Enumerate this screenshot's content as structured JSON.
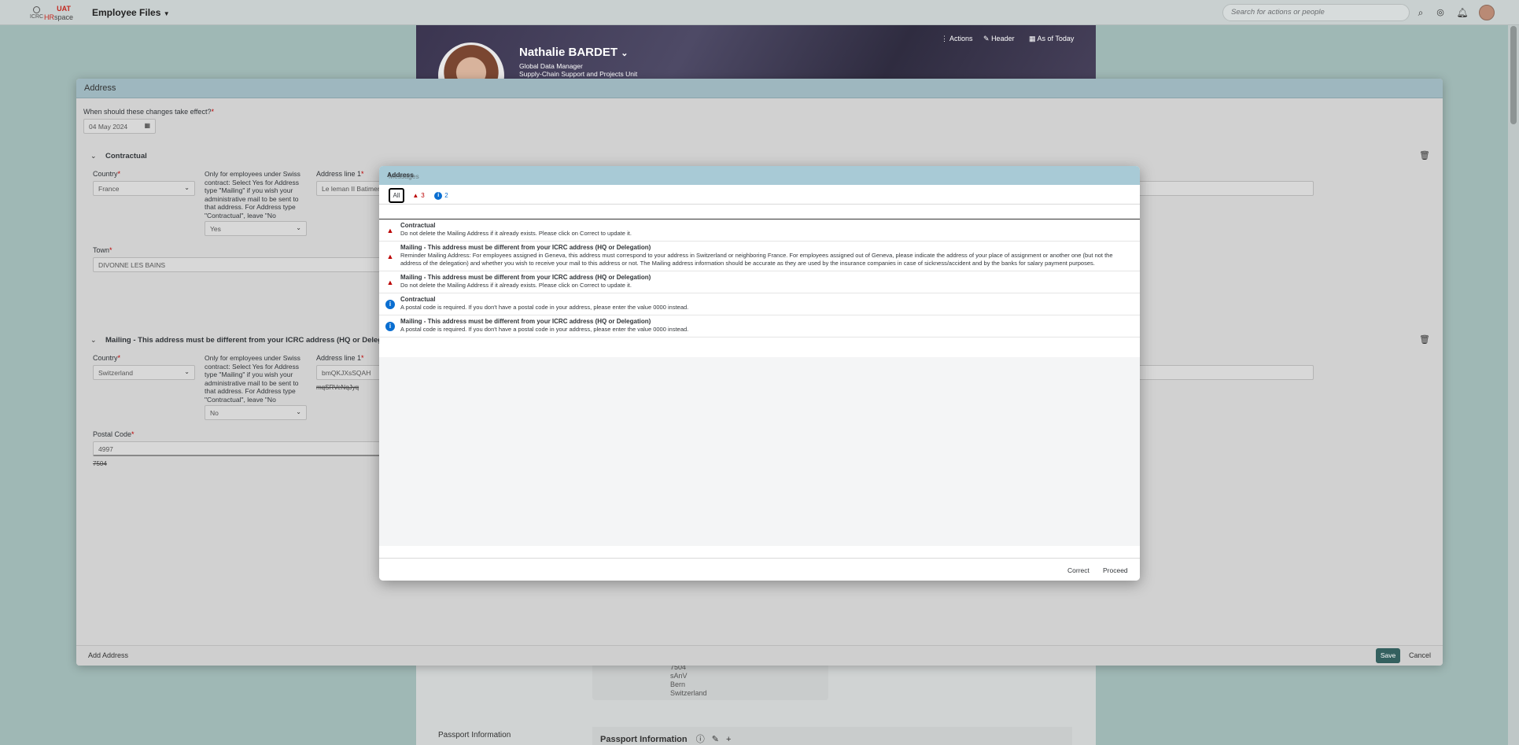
{
  "shell": {
    "logo_uat": "UAT",
    "logo_icrc": "ICRC",
    "logo_hr": "HR",
    "logo_space": "space",
    "app_title": "Employee Files",
    "search_placeholder": "Search for actions or people"
  },
  "profile": {
    "name": "Nathalie BARDET",
    "title": "Global Data Manager",
    "unit": "Supply-Chain Support and Projects Unit",
    "actions_label": "Actions",
    "header_label": "Header",
    "as_of_label": "As of Today"
  },
  "background_page": {
    "address_lines": [
      "7504",
      "sAnV",
      "Bern",
      "Switzerland"
    ],
    "passport_side_label": "Passport Information",
    "passport_title": "Passport Information"
  },
  "address_dialog": {
    "title": "Address",
    "effective_label": "When should these changes take effect?",
    "effective_date": "04 May 2024",
    "swiss_note": "Only for employees under Swiss contract: Select Yes for Address type \"Mailing\" if you wish your administrative mail to be sent to that address. For Address type \"Contractual\", leave \"No selection\".",
    "contractual": {
      "title": "Contractual",
      "country_label": "Country",
      "country_value": "France",
      "swiss_value": "Yes",
      "address1_label": "Address line 1",
      "address1_value": "Le leman II Batiment",
      "town_label": "Town",
      "town_value": "DIVONNE LES BAINS"
    },
    "mailing": {
      "title": "Mailing - This address must be different from your ICRC address (HQ or Delegation)",
      "country_label": "Country",
      "country_value": "Switzerland",
      "swiss_value": "No",
      "address1_label": "Address line 1",
      "address1_value": "bmQKJXsSQAH",
      "address1_old": "mqSRVeNqJyq",
      "postal_label": "Postal Code",
      "postal_value": "4997",
      "postal_old": "7504"
    },
    "add_address_label": "Add Address",
    "save_label": "Save",
    "cancel_label": "Cancel"
  },
  "messages_dialog": {
    "title": "Messages",
    "tab_all": "All",
    "tab_error_count": "3",
    "tab_info_count": "2",
    "group_label": "Address",
    "items": [
      {
        "type": "error",
        "title": "Contractual",
        "desc": "Do not delete the Mailing Address if it already exists. Please click on Correct to update it."
      },
      {
        "type": "error",
        "title": "Mailing - This address must be different from your ICRC address (HQ or Delegation)",
        "desc": "Reminder Mailing Address: For employees assigned in Geneva, this address must correspond to your address in Switzerland or neighboring France. For employees assigned out of Geneva, please indicate the address of your place of assignment or another one (but not the address of the delegation) and whether you wish to receive your mail to this address or not. The Mailing address information should be accurate as they are used by the insurance companies in case of sickness/accident and by the banks for salary payment purposes."
      },
      {
        "type": "error",
        "title": "Mailing - This address must be different from your ICRC address (HQ or Delegation)",
        "desc": "Do not delete the Mailing Address if it already exists. Please click on Correct to update it."
      },
      {
        "type": "info",
        "title": "Contractual",
        "desc": "A postal code is required. If you don't have a postal code in your address, please enter the value 0000 instead."
      },
      {
        "type": "info",
        "title": "Mailing - This address must be different from your ICRC address (HQ or Delegation)",
        "desc": "A postal code is required. If you don't have a postal code in your address, please enter the value 0000 instead."
      }
    ],
    "correct_label": "Correct",
    "proceed_label": "Proceed"
  },
  "colors": {
    "error": "#bb0000",
    "info": "#0a6ed1",
    "save_button": "#34605f",
    "dialog_header": "#a8cad6"
  }
}
